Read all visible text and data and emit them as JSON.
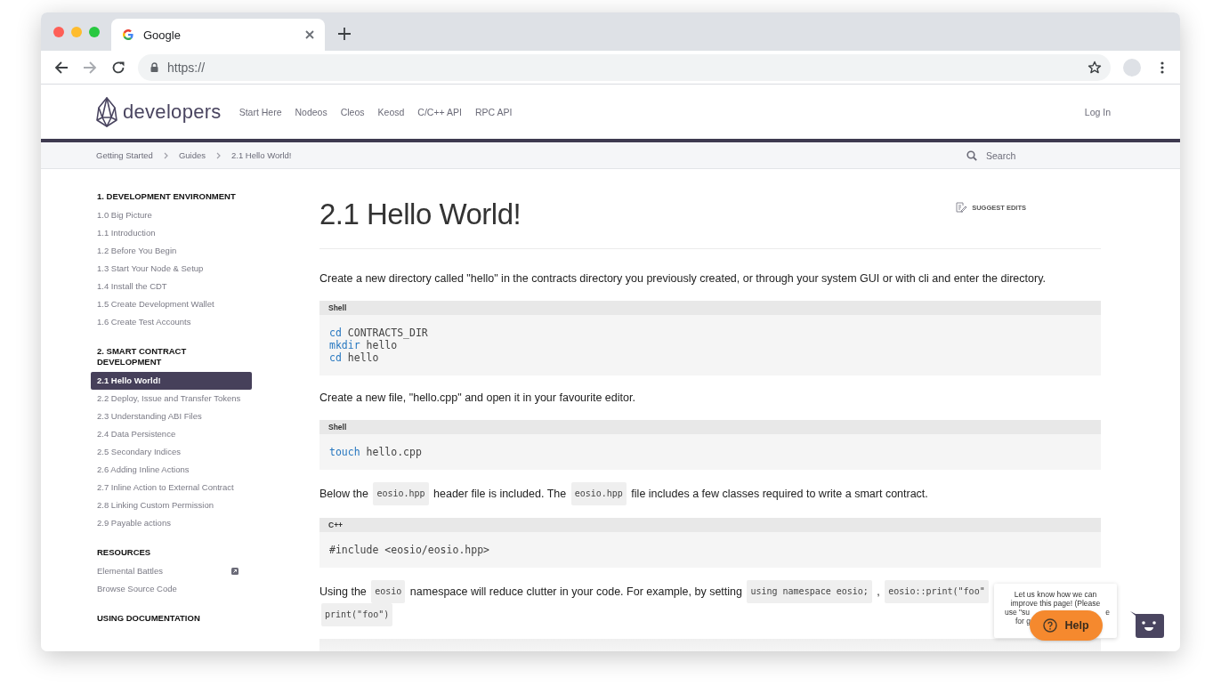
{
  "browser": {
    "tab_title": "Google",
    "url": "https://"
  },
  "site": {
    "logo": "developers",
    "nav": [
      "Start Here",
      "Nodeos",
      "Cleos",
      "Keosd",
      "C/C++ API",
      "RPC API"
    ],
    "login": "Log In"
  },
  "breadcrumb": {
    "items": [
      "Getting Started",
      "Guides",
      "2.1 Hello World!"
    ],
    "search_placeholder": "Search"
  },
  "sidebar": [
    {
      "title": "1. DEVELOPMENT ENVIRONMENT",
      "items": [
        {
          "label": "1.0 Big Picture",
          "selected": false
        },
        {
          "label": "1.1 Introduction",
          "selected": false
        },
        {
          "label": "1.2 Before You Begin",
          "selected": false
        },
        {
          "label": "1.3 Start Your Node & Setup",
          "selected": false
        },
        {
          "label": "1.4 Install the CDT",
          "selected": false
        },
        {
          "label": "1.5 Create Development Wallet",
          "selected": false
        },
        {
          "label": "1.6 Create Test Accounts",
          "selected": false
        }
      ]
    },
    {
      "title": "2. SMART CONTRACT DEVELOPMENT",
      "items": [
        {
          "label": "2.1 Hello World!",
          "selected": true
        },
        {
          "label": "2.2 Deploy, Issue and Transfer Tokens",
          "selected": false
        },
        {
          "label": "2.3 Understanding ABI Files",
          "selected": false
        },
        {
          "label": "2.4 Data Persistence",
          "selected": false
        },
        {
          "label": "2.5 Secondary Indices",
          "selected": false
        },
        {
          "label": "2.6 Adding Inline Actions",
          "selected": false
        },
        {
          "label": "2.7 Inline Action to External Contract",
          "selected": false
        },
        {
          "label": "2.8 Linking Custom Permission",
          "selected": false
        },
        {
          "label": "2.9 Payable actions",
          "selected": false
        }
      ]
    },
    {
      "title": "RESOURCES",
      "items": [
        {
          "label": "Elemental Battles",
          "selected": false,
          "external": true
        },
        {
          "label": "Browse Source Code",
          "selected": false
        }
      ]
    },
    {
      "title": "USING DOCUMENTATION"
    }
  ],
  "article": {
    "title": "2.1 Hello World!",
    "suggest": "SUGGEST EDITS",
    "blocks": [
      {
        "kind": "paragraph",
        "lines": [
          [
            {
              "text": "Create a new directory called \"hello\" in the contracts directory you previously created, or through your system GUI or with cli and enter the directory."
            }
          ]
        ]
      },
      {
        "kind": "code",
        "lang": "Shell",
        "lines": [
          [
            {
              "text": "cd",
              "keyword": true
            },
            {
              "text": " CONTRACTS_DIR"
            }
          ],
          [
            {
              "text": "mkdir",
              "keyword": true
            },
            {
              "text": " hello"
            }
          ],
          [
            {
              "text": "cd",
              "keyword": true
            },
            {
              "text": " hello"
            }
          ]
        ]
      },
      {
        "kind": "paragraph",
        "lines": [
          [
            {
              "text": "Create a new file, \"hello.cpp\" and open it in your favourite editor."
            }
          ]
        ]
      },
      {
        "kind": "code",
        "lang": "Shell",
        "lines": [
          [
            {
              "text": "touch",
              "keyword": true
            },
            {
              "text": " hello.cpp"
            }
          ]
        ]
      },
      {
        "kind": "paragraph",
        "lines": [
          [
            {
              "text": "Below the "
            },
            {
              "text": "eosio.hpp",
              "code": true
            },
            {
              "text": " header file is included. The "
            },
            {
              "text": "eosio.hpp",
              "code": true
            },
            {
              "text": " file includes a few classes required to write a smart contract."
            }
          ]
        ]
      },
      {
        "kind": "code",
        "lang": "C++",
        "lines": [
          [
            {
              "text": "#include <eosio/eosio.hpp>"
            }
          ]
        ]
      },
      {
        "kind": "paragraph",
        "lines": [
          [
            {
              "text": "Using the "
            },
            {
              "text": "eosio",
              "code": true
            },
            {
              "text": " namespace will reduce clutter in your code. For example, by setting "
            },
            {
              "text": "using namespace eosio;",
              "code": true
            },
            {
              "text": " , "
            },
            {
              "text": "eosio::print(\"foo\"",
              "code": true
            }
          ],
          [
            {
              "text": "print(\"foo\")",
              "code": true
            }
          ]
        ]
      },
      {
        "kind": "code"
      }
    ]
  },
  "help": {
    "tooltip": [
      "Let us know how we can",
      "improve this page! (Please"
    ],
    "tooltip_left": "use \"su",
    "tooltip_right": "e",
    "tooltip_last": "for g",
    "button": "Help"
  }
}
